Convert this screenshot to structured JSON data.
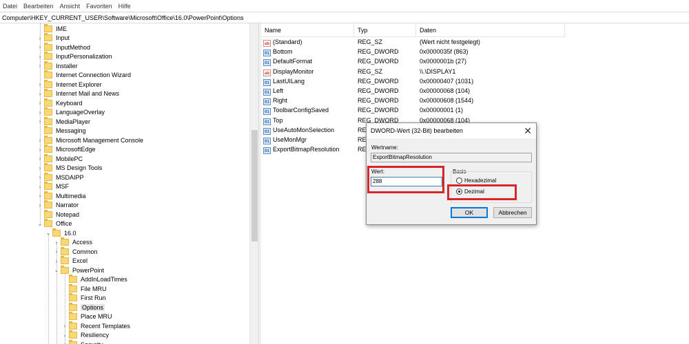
{
  "menu": [
    "Datei",
    "Bearbeiten",
    "Ansicht",
    "Favoriten",
    "Hilfe"
  ],
  "address": "Computer\\HKEY_CURRENT_USER\\Software\\Microsoft\\Office\\16.0\\PowerPoint\\Options",
  "tree": [
    {
      "label": "IME",
      "level": 0,
      "arrow": "none"
    },
    {
      "label": "Input",
      "level": 0,
      "arrow": "collapsed"
    },
    {
      "label": "InputMethod",
      "level": 0,
      "arrow": "collapsed"
    },
    {
      "label": "InputPersonalization",
      "level": 0,
      "arrow": "collapsed"
    },
    {
      "label": "Installer",
      "level": 0,
      "arrow": "collapsed"
    },
    {
      "label": "Internet Connection Wizard",
      "level": 0,
      "arrow": "none"
    },
    {
      "label": "Internet Explorer",
      "level": 0,
      "arrow": "collapsed"
    },
    {
      "label": "Internet Mail and News",
      "level": 0,
      "arrow": "collapsed"
    },
    {
      "label": "Keyboard",
      "level": 0,
      "arrow": "collapsed"
    },
    {
      "label": "LanguageOverlay",
      "level": 0,
      "arrow": "collapsed"
    },
    {
      "label": "MediaPlayer",
      "level": 0,
      "arrow": "collapsed"
    },
    {
      "label": "Messaging",
      "level": 0,
      "arrow": "none"
    },
    {
      "label": "Microsoft Management Console",
      "level": 0,
      "arrow": "collapsed"
    },
    {
      "label": "MicrosoftEdge",
      "level": 0,
      "arrow": "collapsed"
    },
    {
      "label": "MobilePC",
      "level": 0,
      "arrow": "collapsed"
    },
    {
      "label": "MS Design Tools",
      "level": 0,
      "arrow": "collapsed"
    },
    {
      "label": "MSDAIPP",
      "level": 0,
      "arrow": "collapsed"
    },
    {
      "label": "MSF",
      "level": 0,
      "arrow": "collapsed"
    },
    {
      "label": "Multimedia",
      "level": 0,
      "arrow": "collapsed"
    },
    {
      "label": "Narrator",
      "level": 0,
      "arrow": "collapsed"
    },
    {
      "label": "Notepad",
      "level": 0,
      "arrow": "none"
    },
    {
      "label": "Office",
      "level": 0,
      "arrow": "expanded"
    },
    {
      "label": "16.0",
      "level": 1,
      "arrow": "expanded"
    },
    {
      "label": "Access",
      "level": 2,
      "arrow": "collapsed"
    },
    {
      "label": "Common",
      "level": 2,
      "arrow": "collapsed"
    },
    {
      "label": "Excel",
      "level": 2,
      "arrow": "collapsed"
    },
    {
      "label": "PowerPoint",
      "level": 2,
      "arrow": "expanded"
    },
    {
      "label": "AddInLoadTimes",
      "level": 3,
      "arrow": "none"
    },
    {
      "label": "File MRU",
      "level": 3,
      "arrow": "none"
    },
    {
      "label": "First Run",
      "level": 3,
      "arrow": "none"
    },
    {
      "label": "Options",
      "level": 3,
      "arrow": "none",
      "selected": true
    },
    {
      "label": "Place MRU",
      "level": 3,
      "arrow": "none"
    },
    {
      "label": "Recent Templates",
      "level": 3,
      "arrow": "collapsed"
    },
    {
      "label": "Resiliency",
      "level": 3,
      "arrow": "collapsed"
    },
    {
      "label": "Security",
      "level": 3,
      "arrow": "collapsed"
    }
  ],
  "list": {
    "columns": [
      "Name",
      "Typ",
      "Daten"
    ],
    "rows": [
      {
        "name": "(Standard)",
        "type": "REG_SZ",
        "data": "(Wert nicht festgelegt)",
        "icon": "sz"
      },
      {
        "name": "Bottom",
        "type": "REG_DWORD",
        "data": "0x0000035f (863)",
        "icon": "dword"
      },
      {
        "name": "DefaultFormat",
        "type": "REG_DWORD",
        "data": "0x0000001b (27)",
        "icon": "dword"
      },
      {
        "name": "DisplayMonitor",
        "type": "REG_SZ",
        "data": "\\\\.\\DISPLAY1",
        "icon": "sz"
      },
      {
        "name": "LastUILang",
        "type": "REG_DWORD",
        "data": "0x00000407 (1031)",
        "icon": "dword"
      },
      {
        "name": "Left",
        "type": "REG_DWORD",
        "data": "0x00000068 (104)",
        "icon": "dword"
      },
      {
        "name": "Right",
        "type": "REG_DWORD",
        "data": "0x00000608 (1544)",
        "icon": "dword"
      },
      {
        "name": "ToolbarConfigSaved",
        "type": "REG_DWORD",
        "data": "0x00000001 (1)",
        "icon": "dword"
      },
      {
        "name": "Top",
        "type": "REG_DWORD",
        "data": "0x00000068 (104)",
        "icon": "dword"
      },
      {
        "name": "UseAutoMonSelection",
        "type": "REG",
        "data": "",
        "icon": "dword"
      },
      {
        "name": "UseMonMgr",
        "type": "REG",
        "data": "",
        "icon": "dword"
      },
      {
        "name": "ExportBitmapResolution",
        "type": "REG",
        "data": "",
        "icon": "dword"
      }
    ]
  },
  "dialog": {
    "title": "DWORD-Wert (32-Bit) bearbeiten",
    "close_glyph": "✕",
    "name_label": "Wertname:",
    "name_value": "ExportBitmapResolution",
    "value_label": "Wert:",
    "value_value": "288",
    "base_label": "Basis",
    "hex_label": "Hexadezimal",
    "dec_label": "Dezimal",
    "selected_base": "dec",
    "ok_label": "OK",
    "cancel_label": "Abbrechen",
    "highlight_color": "#d6262b"
  }
}
